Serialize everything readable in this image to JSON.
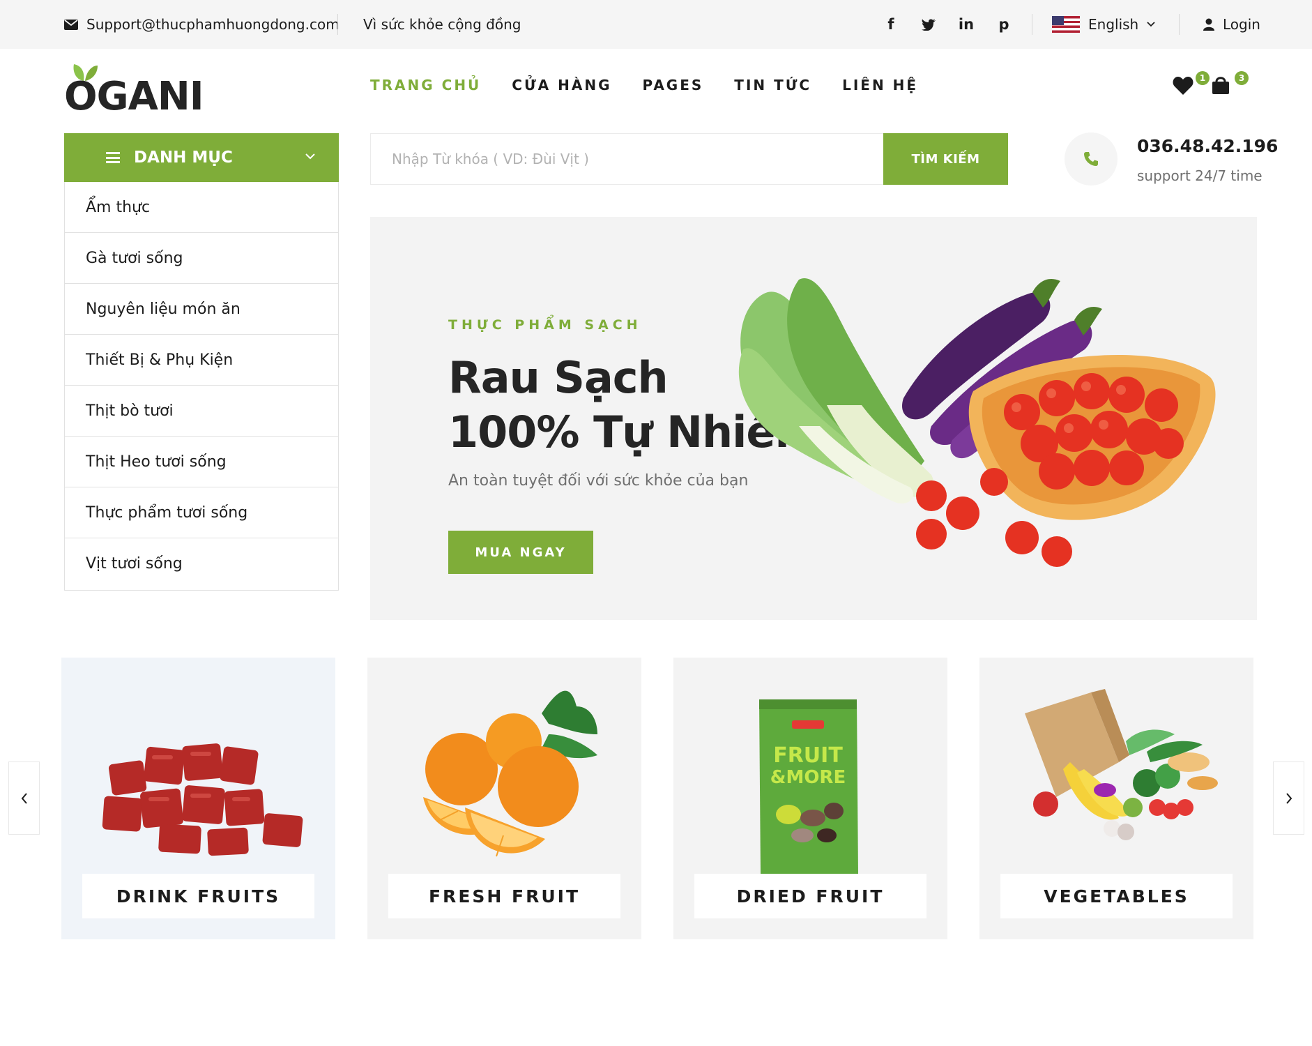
{
  "topbar": {
    "email": "Support@thucphamhuongdong.com",
    "slogan": "Vì sức khỏe cộng đồng",
    "social": {
      "facebook": "f",
      "twitter": "t",
      "linkedin": "in",
      "pinterest": "p"
    },
    "language": "English",
    "login": "Login"
  },
  "header": {
    "logo": "OGANI",
    "nav": [
      "TRANG CHỦ",
      "CỬA HÀNG",
      "PAGES",
      "TIN TỨC",
      "LIÊN HỆ"
    ],
    "wishlist_count": "1",
    "cart_count": "3"
  },
  "categories": {
    "title": "DANH MỤC",
    "items": [
      "Ẩm thực",
      "Gà tươi sống",
      "Nguyên liệu món ăn",
      "Thiết Bị & Phụ Kiện",
      "Thịt bò tươi",
      "Thịt Heo tươi sống",
      "Thực phẩm tươi sống",
      "Vịt tươi sống"
    ]
  },
  "search": {
    "placeholder": "Nhập Từ khóa ( VD: Đùi Vịt )",
    "button": "TÌM KIẾM"
  },
  "contact": {
    "phone": "036.48.42.196",
    "support": "support 24/7 time"
  },
  "hero": {
    "kicker": "THỰC PHẨM SẠCH",
    "title_line1": "Rau Sạch",
    "title_line2": "100% Tự Nhiên",
    "description": "An toàn tuyệt đối với sức khỏe của bạn",
    "cta": "MUA NGAY"
  },
  "category_cards": [
    {
      "label": "DRINK FRUITS",
      "image": "beef-cubes"
    },
    {
      "label": "FRESH FRUIT",
      "image": "oranges"
    },
    {
      "label": "DRIED FRUIT",
      "image": "fruit-and-more-bag",
      "package_text": "FRUIT &MORE"
    },
    {
      "label": "VEGETABLES",
      "image": "grocery-bag"
    }
  ],
  "colors": {
    "accent": "#7fad39",
    "text": "#1c1c1c",
    "muted": "#6f6f6f",
    "topbar_bg": "#f5f5f5",
    "hero_bg": "#f3f3f3"
  }
}
